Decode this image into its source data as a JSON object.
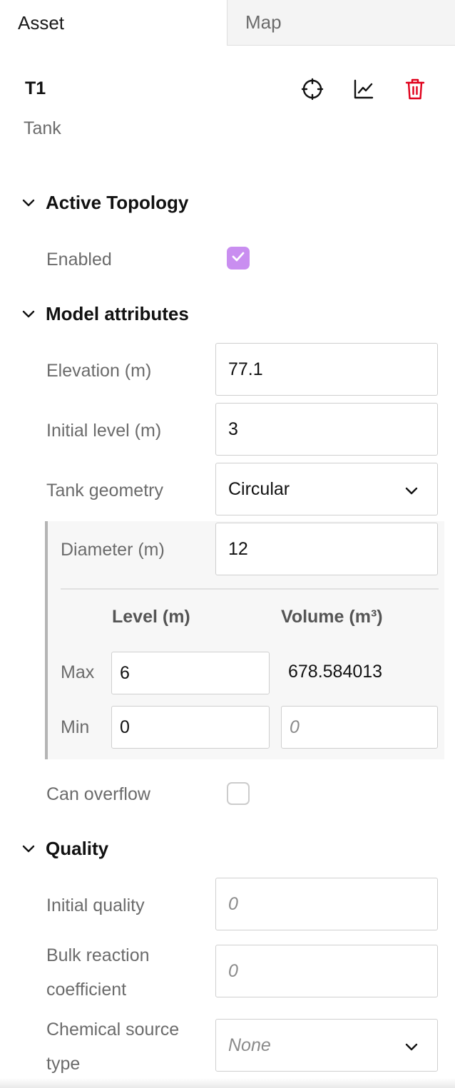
{
  "tabs": [
    {
      "label": "Asset",
      "active": true
    },
    {
      "label": "Map",
      "active": false
    }
  ],
  "asset": {
    "id": "T1",
    "type": "Tank"
  },
  "header_icons": [
    "crosshair-icon",
    "chart-icon",
    "trash-icon"
  ],
  "colors": {
    "accent": "#c98ef0",
    "danger": "#e0001b",
    "muted_text": "#6b6b6b"
  },
  "active_topology": {
    "title": "Active Topology",
    "enabled_label": "Enabled",
    "enabled": true
  },
  "model_attributes": {
    "title": "Model attributes",
    "elevation_label": "Elevation (m)",
    "elevation_value": "77.1",
    "initial_level_label": "Initial level (m)",
    "initial_level_value": "3",
    "tank_geometry_label": "Tank geometry",
    "tank_geometry_value": "Circular",
    "diameter_label": "Diameter (m)",
    "diameter_value": "12",
    "level_header": "Level (m)",
    "volume_header": "Volume (m³)",
    "max_label": "Max",
    "max_level": "6",
    "max_volume": "678.584013",
    "min_label": "Min",
    "min_level": "0",
    "min_volume_placeholder": "0",
    "overflow_label": "Can overflow",
    "can_overflow": false
  },
  "quality": {
    "title": "Quality",
    "initial_quality_label": "Initial quality",
    "initial_quality_placeholder": "0",
    "bulk_label_line1": "Bulk reaction",
    "bulk_label_line2": "coefficient",
    "bulk_placeholder": "0",
    "chemical_label_line1": "Chemical source",
    "chemical_label_line2": "type",
    "chemical_value": "None"
  }
}
